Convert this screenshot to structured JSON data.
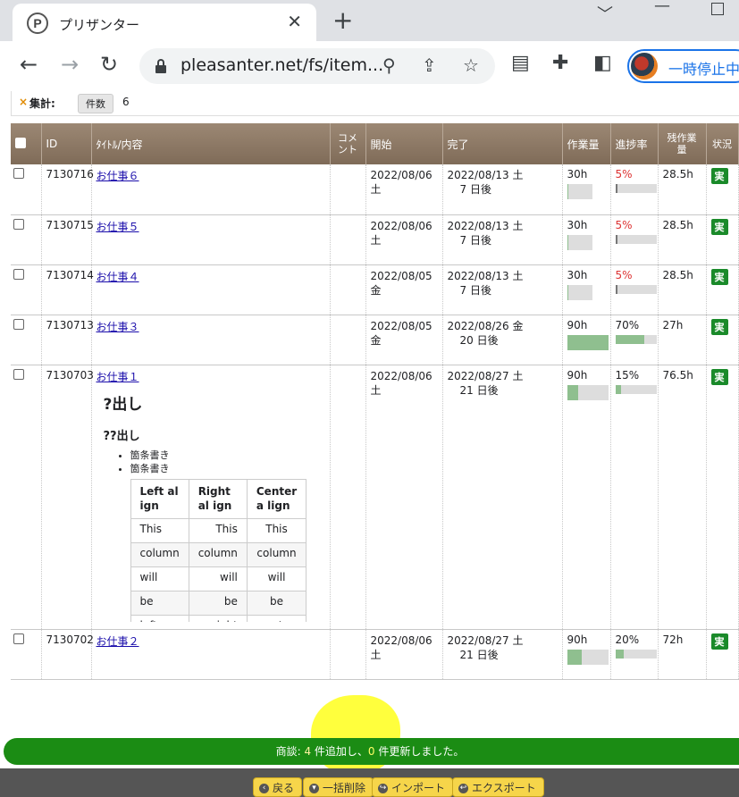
{
  "browser": {
    "tab_title": "プリザンター",
    "tab_favicon": "P",
    "url": "pleasanter.net/fs/item...",
    "profile_label": "一時停止中"
  },
  "summary": {
    "label": "集計:",
    "chip": "件数",
    "count": "6"
  },
  "columns": {
    "id": "ID",
    "title": "ﾀｲﾄﾙ/内容",
    "comment": "コメント",
    "start": "開始",
    "end": "完了",
    "work": "作業量",
    "progress": "進捗率",
    "remaining": "残作業量",
    "status": "状況"
  },
  "rows": [
    {
      "id": "7130716",
      "title": "お仕事６",
      "start": "2022/08/06",
      "start_day": "土",
      "end": "2022/08/13 土",
      "end_rel": "7 日後",
      "work": "30h",
      "progress": "5%",
      "remaining": "28.5h",
      "status": "実"
    },
    {
      "id": "7130715",
      "title": "お仕事５",
      "start": "2022/08/06",
      "start_day": "土",
      "end": "2022/08/13 土",
      "end_rel": "7 日後",
      "work": "30h",
      "progress": "5%",
      "remaining": "28.5h",
      "status": "実"
    },
    {
      "id": "7130714",
      "title": "お仕事４",
      "start": "2022/08/05",
      "start_day": "金",
      "end": "2022/08/13 土",
      "end_rel": "7 日後",
      "work": "30h",
      "progress": "5%",
      "remaining": "28.5h",
      "status": "実"
    },
    {
      "id": "7130713",
      "title": "お仕事３",
      "start": "2022/08/05",
      "start_day": "金",
      "end": "2022/08/26 金",
      "end_rel": "20 日後",
      "work": "90h",
      "progress": "70%",
      "remaining": "27h",
      "status": "実"
    },
    {
      "id": "7130703",
      "title": "お仕事１",
      "start": "2022/08/06",
      "start_day": "土",
      "end": "2022/08/27 土",
      "end_rel": "21 日後",
      "work": "90h",
      "progress": "15%",
      "remaining": "76.5h",
      "status": "実",
      "body": {
        "h2": "?出し",
        "h3": "??出し",
        "bullets": [
          "箇条書き",
          "箇条書き"
        ],
        "table_head": [
          "Left al ign",
          "Right al ign",
          "Center a lign"
        ],
        "table_rows": [
          [
            "This",
            "This",
            "This"
          ],
          [
            "column",
            "column",
            "column"
          ],
          [
            "will",
            "will",
            "will"
          ],
          [
            "be",
            "be",
            "be"
          ],
          [
            "left",
            "right",
            "center"
          ]
        ]
      }
    },
    {
      "id": "7130702",
      "title": "お仕事２",
      "start": "2022/08/06",
      "start_day": "土",
      "end": "2022/08/27 土",
      "end_rel": "21 日後",
      "work": "90h",
      "progress": "20%",
      "remaining": "72h",
      "status": "実"
    }
  ],
  "bar_levels": {
    "work_fill": [
      0.05,
      0.05,
      0.05,
      1.0,
      0.28,
      0.35
    ],
    "progress_fill": [
      0.05,
      0.05,
      0.05,
      0.7,
      0.15,
      0.2
    ]
  },
  "notification": {
    "prefix": "商談: ",
    "added": "4",
    "mid": " 件追加し、",
    "updated": "0",
    "suffix": " 件更新しました。"
  },
  "actions": {
    "back": "戻る",
    "bulk_delete": "一括削除",
    "import": "インポート",
    "export": "エクスポート"
  },
  "colors": {
    "header_brown": "#8c7864",
    "notify_green": "#1b8c14",
    "status_green": "#1a8a2a",
    "action_yellow": "#f6d54a"
  }
}
